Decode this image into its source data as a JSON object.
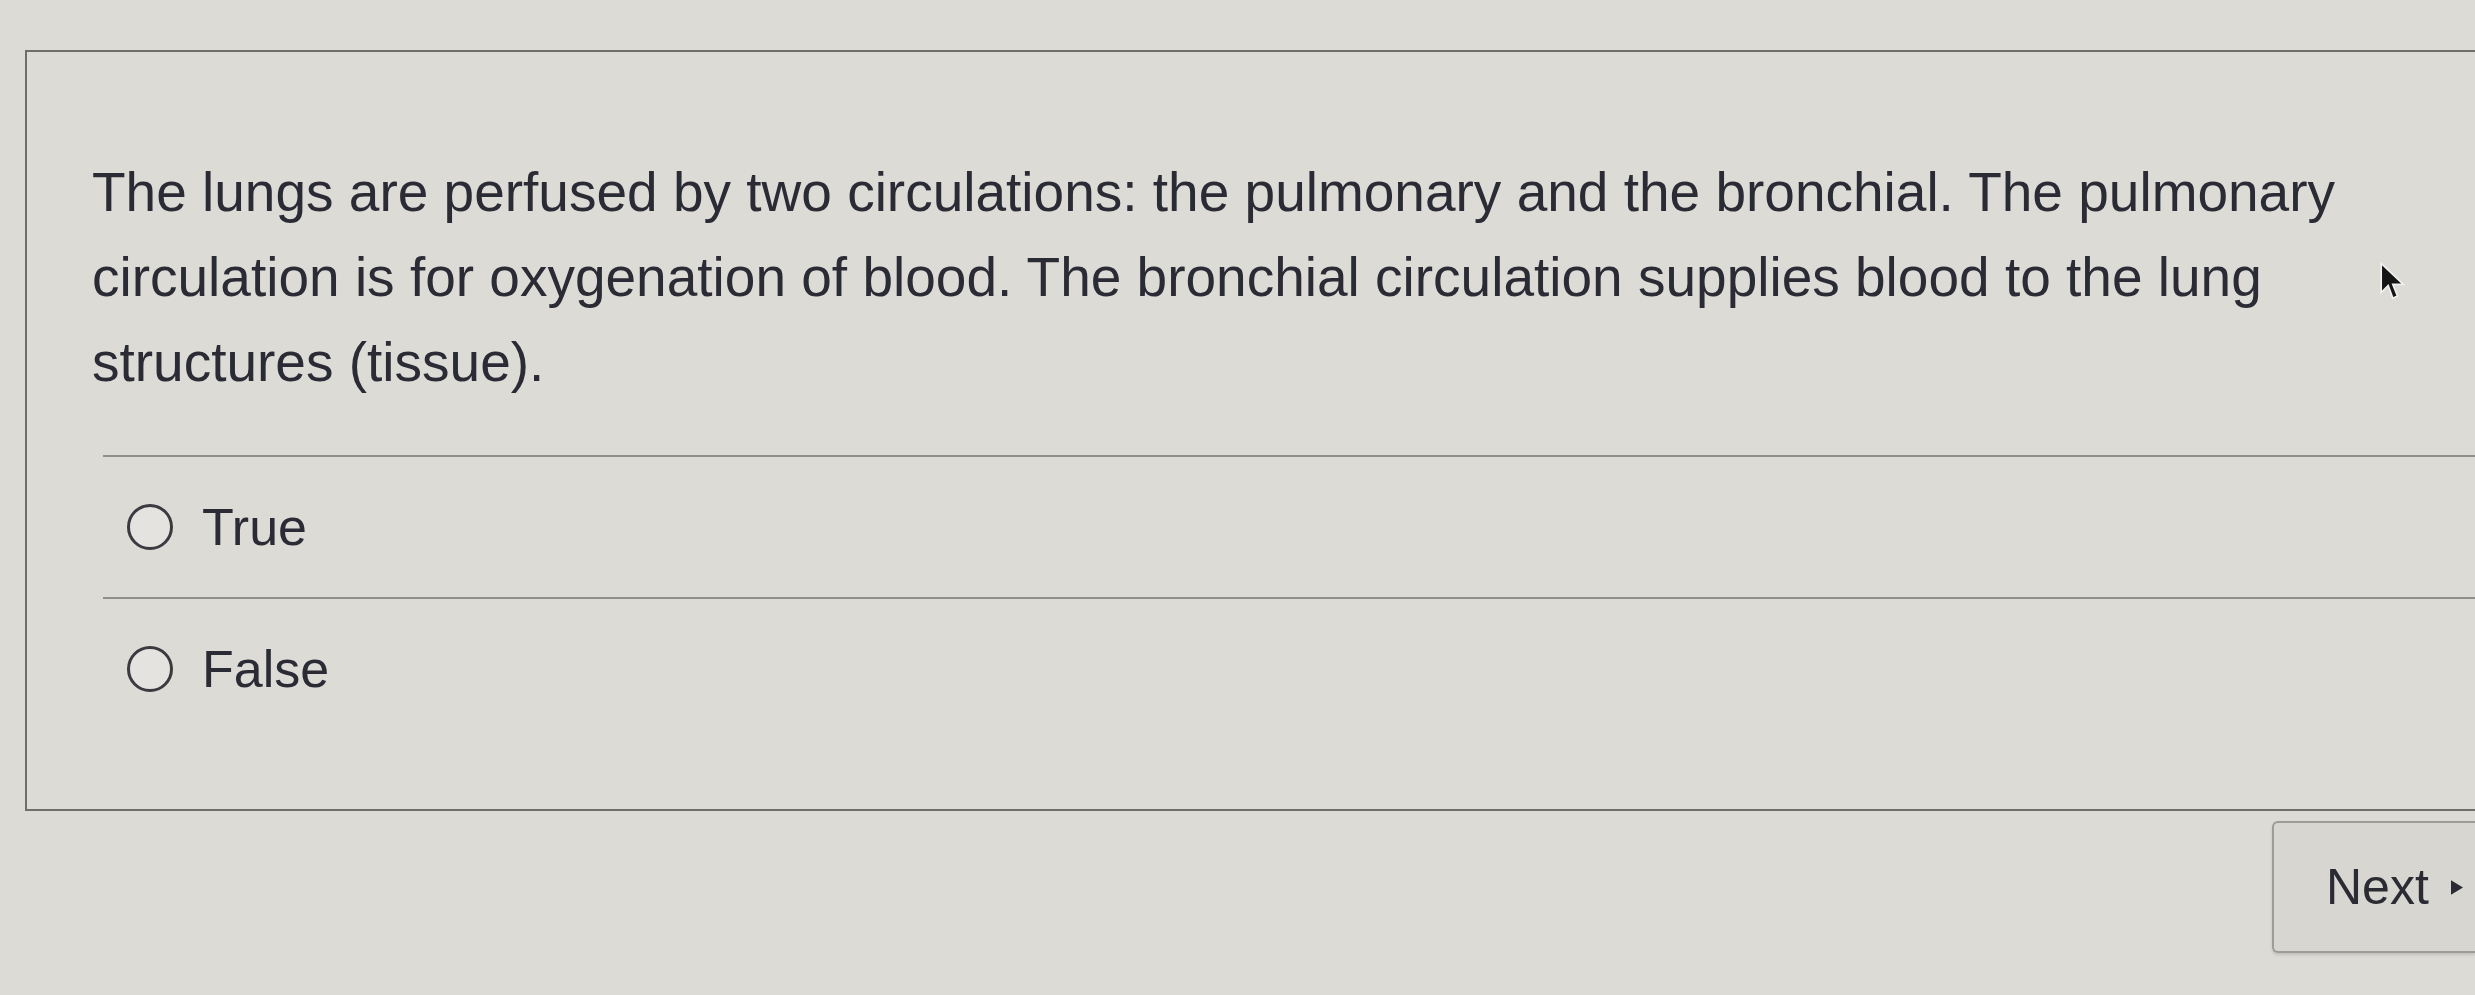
{
  "question": {
    "text": "The lungs are perfused by two circulations: the pulmonary and the bronchial. The pulmonary circulation is for oxygenation of blood. The bronchial circulation supplies blood to the lung structures (tissue)."
  },
  "options": [
    {
      "label": "True",
      "selected": false
    },
    {
      "label": "False",
      "selected": false
    }
  ],
  "next_button": {
    "label": "Next"
  }
}
